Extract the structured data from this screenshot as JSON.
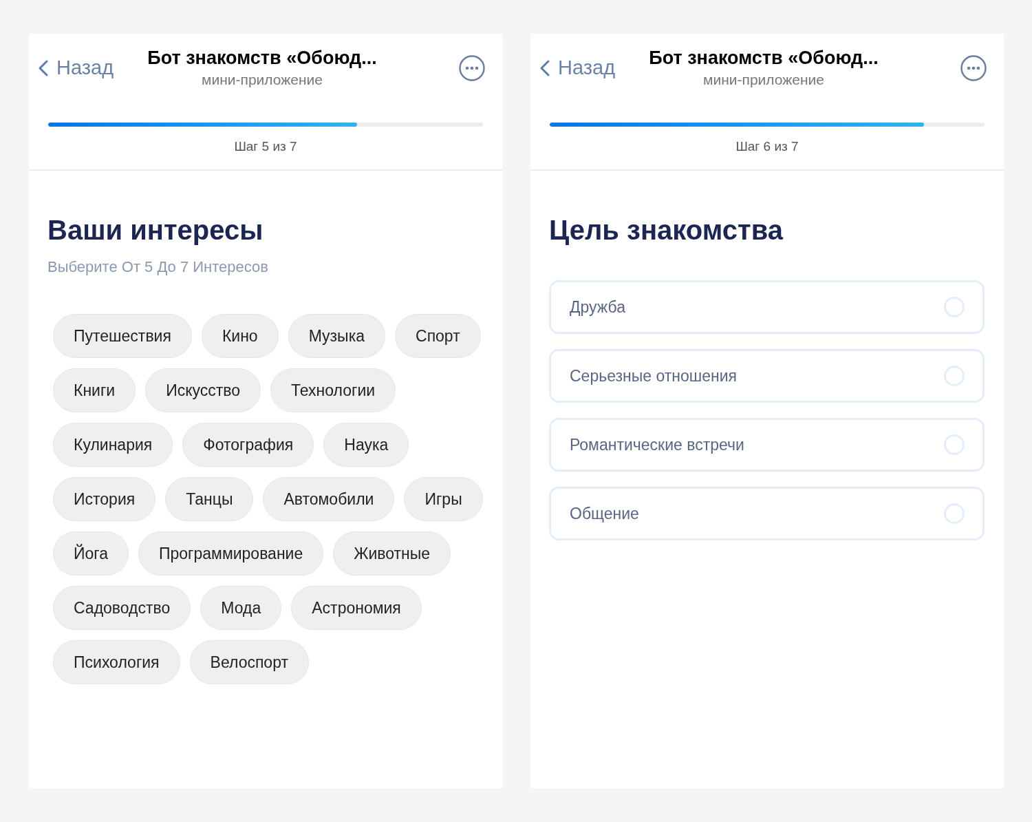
{
  "screens": [
    {
      "header": {
        "back": "Назад",
        "title": "Бот знакомств «Обоюд...",
        "subtitle": "мини-приложение"
      },
      "progress": {
        "level": 0.71,
        "label": "Шаг 5 из 7"
      },
      "heading": "Ваши интересы",
      "hint": "Выберите От 5 До 7 Интересов",
      "kind": "chips",
      "items": [
        {
          "label": "Путешествия",
          "selected": false
        },
        {
          "label": "Кино",
          "selected": false
        },
        {
          "label": "Музыка",
          "selected": false
        },
        {
          "label": "Спорт",
          "selected": false
        },
        {
          "label": "Книги",
          "selected": false
        },
        {
          "label": "Искусство",
          "selected": false
        },
        {
          "label": "Технологии",
          "selected": false
        },
        {
          "label": "Кулинария",
          "selected": false
        },
        {
          "label": "Фотография",
          "selected": false
        },
        {
          "label": "Наука",
          "selected": false
        },
        {
          "label": "История",
          "selected": false
        },
        {
          "label": "Танцы",
          "selected": false
        },
        {
          "label": "Автомобили",
          "selected": false
        },
        {
          "label": "Игры",
          "selected": false
        },
        {
          "label": "Йога",
          "selected": false
        },
        {
          "label": "Программирование",
          "selected": false
        },
        {
          "label": "Животные",
          "selected": false
        },
        {
          "label": "Садоводство",
          "selected": false
        },
        {
          "label": "Мода",
          "selected": false
        },
        {
          "label": "Астрономия",
          "selected": false
        },
        {
          "label": "Психология",
          "selected": false
        },
        {
          "label": "Велоспорт",
          "selected": false
        }
      ]
    },
    {
      "header": {
        "back": "Назад",
        "title": "Бот знакомств «Обоюд...",
        "subtitle": "мини-приложение"
      },
      "progress": {
        "level": 0.86,
        "label": "Шаг 6 из 7"
      },
      "heading": "Цель знакомства",
      "kind": "options",
      "items": [
        {
          "label": "Дружба",
          "selected": false
        },
        {
          "label": "Серьезные отношения",
          "selected": false
        },
        {
          "label": "Романтические встречи",
          "selected": false
        },
        {
          "label": "Общение",
          "selected": false
        }
      ]
    }
  ]
}
